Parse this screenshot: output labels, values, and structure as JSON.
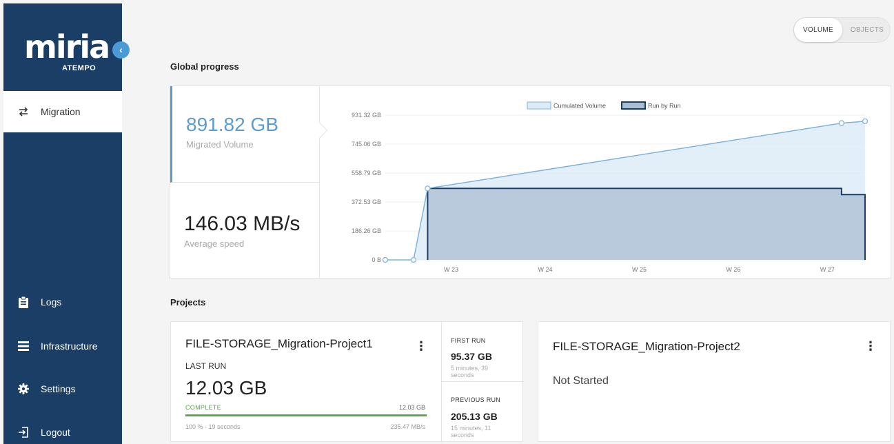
{
  "brand": {
    "logo_text": "miria",
    "logo_sub": "ATEMPO",
    "accent": "#1b3e66",
    "highlight": "#4a9ad8"
  },
  "sidebar": {
    "collapse_icon": "chevron-left-icon",
    "items": [
      {
        "label": "Migration",
        "icon": "swap-arrows-icon",
        "active": true
      },
      {
        "label": "Logs",
        "icon": "clipboard-icon"
      },
      {
        "label": "Infrastructure",
        "icon": "list-icon"
      },
      {
        "label": "Settings",
        "icon": "gear-icon"
      },
      {
        "label": "Logout",
        "icon": "logout-icon"
      }
    ]
  },
  "toggle": {
    "volume": "VOLUME",
    "objects": "OBJECTS",
    "selected": "VOLUME"
  },
  "global_progress": {
    "title": "Global progress",
    "migrated_volume": "891.82 GB",
    "migrated_label": "Migrated Volume",
    "average_speed": "146.03 MB/s",
    "speed_label": "Average speed"
  },
  "chart_data": {
    "type": "area",
    "legend": [
      "Cumulated Volume",
      "Run by Run"
    ],
    "legend_position": "top-center",
    "y_ticks": [
      "931.32 GB",
      "745.06 GB",
      "558.79 GB",
      "372.53 GB",
      "186.26 GB",
      "0 B"
    ],
    "y_tick_values": [
      931.32,
      745.06,
      558.79,
      372.53,
      186.26,
      0
    ],
    "x_ticks": [
      "W 23",
      "W 24",
      "W 25",
      "W 26",
      "W 27"
    ],
    "x_range": [
      22.3,
      27.4
    ],
    "ylim": [
      0,
      931.32
    ],
    "grid": true,
    "series": [
      {
        "name": "Cumulated Volume",
        "color": "#7fb3d9",
        "fill": "#dcebf6",
        "points": [
          [
            22.3,
            0
          ],
          [
            22.6,
            0
          ],
          [
            22.75,
            460
          ],
          [
            27.15,
            880
          ],
          [
            27.4,
            891.82
          ]
        ],
        "markers": [
          [
            22.3,
            0
          ],
          [
            22.6,
            0
          ],
          [
            22.75,
            460
          ],
          [
            27.15,
            880
          ],
          [
            27.4,
            891.82
          ]
        ]
      },
      {
        "name": "Run by Run",
        "color": "#1b3e66",
        "fill": "#a9bed3",
        "points": [
          [
            22.75,
            0
          ],
          [
            22.75,
            460
          ],
          [
            27.15,
            460
          ],
          [
            27.15,
            420
          ],
          [
            27.4,
            420
          ],
          [
            27.4,
            0
          ]
        ]
      }
    ]
  },
  "projects": {
    "title": "Projects",
    "items": [
      {
        "name": "FILE-STORAGE_Migration-Project1",
        "last_run_label": "LAST RUN",
        "last_run_value": "12.03 GB",
        "status": "COMPLETE",
        "status_size": "12.03 GB",
        "progress": 1.0,
        "detail": "100 % - 19 seconds",
        "speed": "235.47 MB/s",
        "first_run_label": "FIRST RUN",
        "first_run_value": "95.37 GB",
        "first_run_time": "5 minutes, 39 seconds",
        "previous_run_label": "PREVIOUS RUN",
        "previous_run_value": "205.13 GB",
        "previous_run_time": "15 minutes, 11 seconds"
      },
      {
        "name": "FILE-STORAGE_Migration-Project2",
        "status": "Not Started"
      }
    ]
  }
}
